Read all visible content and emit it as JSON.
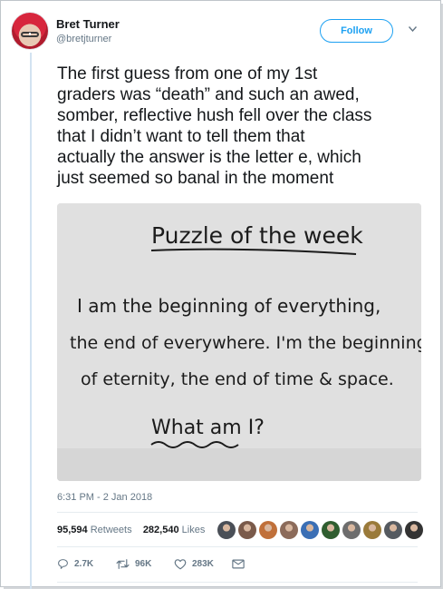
{
  "author": {
    "name": "Bret Turner",
    "handle": "@bretjturner"
  },
  "follow_button_label": "Follow",
  "tweet_lines": [
    "The first guess from one of my 1st",
    "graders was “death” and such an awed,",
    "somber, reflective hush fell over the class",
    "that I didn’t want to tell them that",
    "actually the answer is the letter e, which",
    "just seemed so banal in the moment"
  ],
  "photo": {
    "whiteboard_title": "Puzzle of the week",
    "whiteboard_lines": [
      "I am the beginning of everything,",
      "the end of everywhere. I'm the beginning",
      "of eternity, the end of time & space."
    ],
    "whiteboard_question": "What am I?"
  },
  "timestamp": "6:31 PM - 2 Jan 2018",
  "stats": {
    "retweets_count": "95,594",
    "retweets_label": "Retweets",
    "likes_count": "282,540",
    "likes_label": "Likes"
  },
  "liker_avatar_colors": [
    "#4a4f57",
    "#7a5a4a",
    "#c0703a",
    "#8c6b5a",
    "#3b6fb5",
    "#2f5d2f",
    "#6d6d6d",
    "#9a7a3a",
    "#555a60",
    "#333333"
  ],
  "actions": {
    "reply_count": "2.7K",
    "retweet_count": "96K",
    "like_count": "283K"
  },
  "colors": {
    "accent": "#1da1f2",
    "secondary_text": "#657786",
    "thread_line": "#d3e3f1"
  }
}
